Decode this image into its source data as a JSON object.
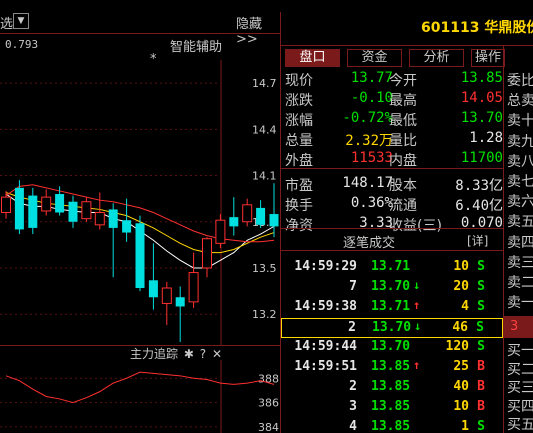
{
  "left_panel": {
    "selector_text": "选",
    "selector_arrow": "▼",
    "hide_label": "隐藏 >>",
    "ref_price": "0.793",
    "assist_label": "智能辅助",
    "star": "*",
    "yaxis_labels": [
      "14.7",
      "14.4",
      "14.1",
      "13.8",
      "13.5",
      "13.2"
    ],
    "low_annotation": "13.02→",
    "indicator": {
      "title": "主力追踪",
      "icons": [
        "gear-icon",
        "help-icon",
        "close-icon"
      ],
      "icon_glyphs": [
        "✱",
        "?",
        "✕"
      ],
      "yaxis_labels": [
        "388",
        "386",
        "384"
      ]
    }
  },
  "chart_data": [
    {
      "type": "candlestick",
      "title": "",
      "ylim": [
        13.0,
        14.85
      ],
      "yticks": [
        14.7,
        14.4,
        14.1,
        13.8,
        13.5,
        13.2
      ],
      "annotation": "13.02",
      "candles": [
        {
          "open": 13.86,
          "close": 13.96,
          "high": 14.0,
          "low": 13.82
        },
        {
          "open": 14.02,
          "close": 13.75,
          "high": 14.07,
          "low": 13.72
        },
        {
          "open": 13.97,
          "close": 13.76,
          "high": 14.02,
          "low": 13.72
        },
        {
          "open": 13.87,
          "close": 13.96,
          "high": 14.01,
          "low": 13.84
        },
        {
          "open": 13.98,
          "close": 13.86,
          "high": 14.03,
          "low": 13.84
        },
        {
          "open": 13.93,
          "close": 13.8,
          "high": 13.97,
          "low": 13.76
        },
        {
          "open": 13.82,
          "close": 13.93,
          "high": 13.96,
          "low": 13.8
        },
        {
          "open": 13.78,
          "close": 13.86,
          "high": 13.99,
          "low": 13.75
        },
        {
          "open": 13.88,
          "close": 13.76,
          "high": 13.92,
          "low": 13.44
        },
        {
          "open": 13.81,
          "close": 13.73,
          "high": 13.95,
          "low": 13.67
        },
        {
          "open": 13.79,
          "close": 13.37,
          "high": 13.84,
          "low": 13.35
        },
        {
          "open": 13.42,
          "close": 13.31,
          "high": 13.66,
          "low": 13.23
        },
        {
          "open": 13.27,
          "close": 13.37,
          "high": 13.41,
          "low": 13.13
        },
        {
          "open": 13.31,
          "close": 13.25,
          "high": 13.38,
          "low": 13.02
        },
        {
          "open": 13.28,
          "close": 13.47,
          "high": 13.6,
          "low": 13.24
        },
        {
          "open": 13.5,
          "close": 13.69,
          "high": 13.7,
          "low": 13.44
        },
        {
          "open": 13.66,
          "close": 13.81,
          "high": 13.85,
          "low": 13.63
        },
        {
          "open": 13.83,
          "close": 13.77,
          "high": 13.96,
          "low": 13.71
        },
        {
          "open": 13.8,
          "close": 13.91,
          "high": 13.95,
          "low": 13.77
        },
        {
          "open": 13.89,
          "close": 13.78,
          "high": 13.94,
          "low": 13.76
        },
        {
          "open": 13.85,
          "close": 13.77,
          "high": 14.05,
          "low": 13.7
        }
      ],
      "ma_lines": [
        {
          "color": "#ffffff",
          "values": [
            13.98,
            13.92,
            13.9,
            13.9,
            13.88,
            13.87,
            13.86,
            13.86,
            13.82,
            13.8,
            13.74,
            13.68,
            13.61,
            13.55,
            13.5,
            13.5,
            13.55,
            13.6,
            13.68,
            13.72,
            13.77
          ]
        },
        {
          "color": "#ffd700",
          "values": [
            13.99,
            13.96,
            13.94,
            13.92,
            13.91,
            13.9,
            13.89,
            13.88,
            13.86,
            13.84,
            13.8,
            13.76,
            13.71,
            13.66,
            13.62,
            13.6,
            13.6,
            13.62,
            13.66,
            13.7,
            13.73
          ]
        },
        {
          "color": "#ff3030",
          "values": [
            13.97,
            14.03,
            14.04,
            14.02,
            14.0,
            13.98,
            13.96,
            13.94,
            13.93,
            13.91,
            13.89,
            13.86,
            13.82,
            13.78,
            13.74,
            13.71,
            13.69,
            13.68,
            13.67,
            13.67,
            13.68
          ]
        }
      ]
    },
    {
      "type": "line",
      "title": "主力追踪",
      "ylim": [
        383.5,
        389.5
      ],
      "yticks": [
        388,
        386,
        384
      ],
      "series": [
        {
          "color": "#ff3030",
          "values": [
            388.2,
            387.8,
            387.1,
            386.5,
            386.3,
            386.0,
            386.4,
            386.9,
            387.6,
            388.0,
            388.5,
            388.4,
            388.3,
            388.2,
            388.0,
            387.9,
            387.6,
            387.5,
            387.6,
            387.8,
            387.5
          ]
        }
      ]
    }
  ],
  "right_panel": {
    "stock_title": "601113 华鼎股份",
    "tabs": [
      "盘口",
      "资金",
      "分析",
      "操作"
    ],
    "quote_rows": [
      {
        "l1": "现价",
        "v1": "13.77",
        "c1": "green",
        "l2": "今开",
        "v2": "13.85",
        "c2": "green"
      },
      {
        "l1": "涨跌",
        "v1": "-0.10",
        "c1": "green",
        "l2": "最高",
        "v2": "14.05",
        "c2": "red"
      },
      {
        "l1": "涨幅",
        "v1": "-0.72%",
        "c1": "green",
        "l2": "最低",
        "v2": "13.70",
        "c2": "green"
      },
      {
        "l1": "总量",
        "v1": "2.32万",
        "c1": "yellow",
        "l2": "量比",
        "v2": "1.28",
        "c2": "white"
      },
      {
        "l1": "外盘",
        "v1": "11533",
        "c1": "red",
        "l2": "内盘",
        "v2": "11700",
        "c2": "green"
      },
      {
        "l1": "市盈",
        "v1": "148.17",
        "c1": "white",
        "l2": "股本",
        "v2": "8.33亿",
        "c2": "white"
      },
      {
        "l1": "换手",
        "v1": "0.36%",
        "c1": "white",
        "l2": "流通",
        "v2": "6.40亿",
        "c2": "white"
      },
      {
        "l1": "净资",
        "v1": "3.33",
        "c1": "white",
        "l2": "收益(三)",
        "v2": "0.070",
        "c2": "white"
      }
    ],
    "trades_title": "逐笔成交",
    "trades_detail": "[详]",
    "trades": [
      {
        "time": "14:59:29",
        "price": "13.71",
        "pc": "green",
        "arrow": "",
        "ac": "",
        "vol": "10",
        "bs": "S",
        "bc": "green",
        "sel": false
      },
      {
        "time": "7",
        "price": "13.70",
        "pc": "green",
        "arrow": "↓",
        "ac": "green",
        "vol": "20",
        "bs": "S",
        "bc": "green",
        "sel": false
      },
      {
        "time": "14:59:38",
        "price": "13.71",
        "pc": "green",
        "arrow": "↑",
        "ac": "red",
        "vol": "4",
        "bs": "S",
        "bc": "green",
        "sel": false
      },
      {
        "time": "2",
        "price": "13.70",
        "pc": "green",
        "arrow": "↓",
        "ac": "green",
        "vol": "46",
        "bs": "S",
        "bc": "green",
        "sel": true
      },
      {
        "time": "14:59:44",
        "price": "13.70",
        "pc": "green",
        "arrow": "",
        "ac": "",
        "vol": "120",
        "bs": "S",
        "bc": "green",
        "sel": false
      },
      {
        "time": "14:59:51",
        "price": "13.85",
        "pc": "green",
        "arrow": "↑",
        "ac": "red",
        "vol": "25",
        "bs": "B",
        "bc": "red",
        "sel": false
      },
      {
        "time": "2",
        "price": "13.85",
        "pc": "green",
        "arrow": "",
        "ac": "",
        "vol": "40",
        "bs": "B",
        "bc": "red",
        "sel": false
      },
      {
        "time": "3",
        "price": "13.85",
        "pc": "green",
        "arrow": "",
        "ac": "",
        "vol": "10",
        "bs": "B",
        "bc": "red",
        "sel": false
      },
      {
        "time": "4",
        "price": "13.85",
        "pc": "green",
        "arrow": "",
        "ac": "",
        "vol": "1",
        "bs": "S",
        "bc": "green",
        "sel": false
      }
    ],
    "far_column": {
      "labels": [
        "委比",
        "总卖",
        "卖十",
        "卖九",
        "卖八",
        "卖七",
        "卖六",
        "卖五",
        "卖四",
        "卖三",
        "卖二",
        "卖一"
      ],
      "mid_value": "3",
      "buy_labels": [
        "买一",
        "买二",
        "买三",
        "买四",
        "买五",
        "买六"
      ]
    }
  }
}
